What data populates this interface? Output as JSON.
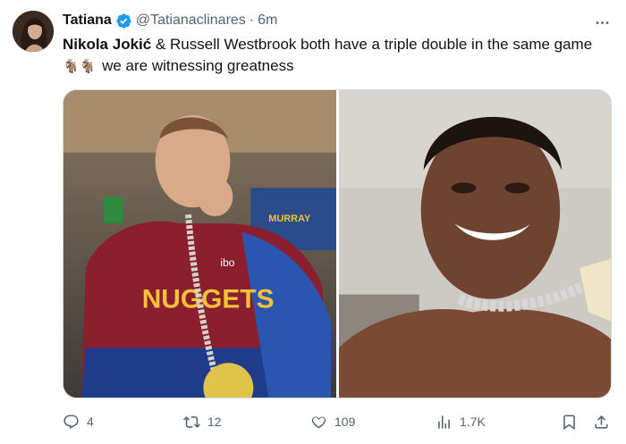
{
  "tweet": {
    "author_name": "Tatiana",
    "handle": "@Tatianaclinares",
    "separator": "·",
    "time": "6m",
    "text_bold": "Nikola Jokić",
    "text_part1": " & Russell Westbrook both have a triple double in the same game ",
    "emoji": "🐐🐐",
    "text_part2": " we are witnessing greatness",
    "more_label": "···"
  },
  "media": {
    "left_image_jersey_text": "NUGGETS",
    "left_image_sponsor_text": "ibo",
    "left_image_screen_text": "MURRAY"
  },
  "actions": {
    "replies": "4",
    "reposts": "12",
    "likes": "109",
    "views": "1.7K"
  },
  "colors": {
    "text_primary": "#0f1419",
    "text_secondary": "#536471",
    "verified_blue": "#1d9bf0",
    "border": "#cfd9de"
  },
  "icons": {
    "reply": "reply-icon",
    "repost": "repost-icon",
    "like": "like-icon",
    "views": "views-icon",
    "bookmark": "bookmark-icon",
    "share": "share-icon",
    "more": "more-icon",
    "verified": "verified-badge-icon"
  }
}
